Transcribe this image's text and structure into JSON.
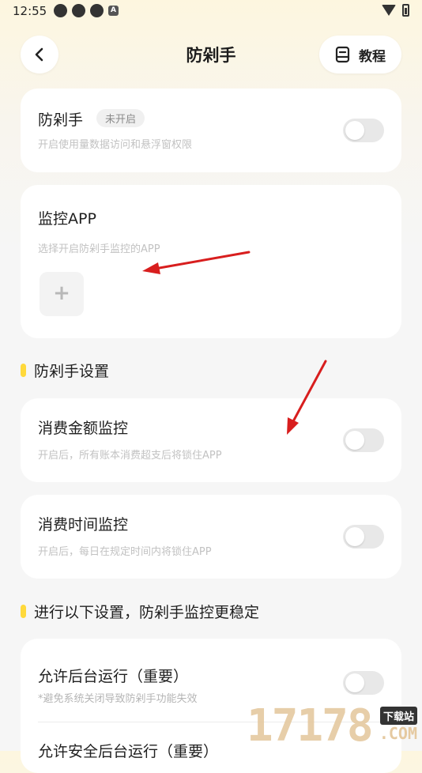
{
  "status_bar": {
    "time": "12:55",
    "a_icon": "A"
  },
  "header": {
    "title": "防剁手",
    "tutorial_label": "教程"
  },
  "card_main": {
    "title": "防剁手",
    "badge": "未开启",
    "subtitle": "开启使用量数据访问和悬浮窗权限",
    "toggle_on": false
  },
  "card_monitor": {
    "title": "监控APP",
    "subtitle": "选择开启防剁手监控的APP",
    "add_icon": "+"
  },
  "section_settings": {
    "title": "防剁手设置"
  },
  "card_amount": {
    "title": "消费金额监控",
    "subtitle": "开启后，所有账本消费超支后将锁住APP",
    "toggle_on": false
  },
  "card_time": {
    "title": "消费时间监控",
    "subtitle": "开启后，每日在规定时间内将锁住APP",
    "toggle_on": false
  },
  "section_stable": {
    "title": "进行以下设置，防剁手监控更稳定"
  },
  "card_background": {
    "item1": {
      "title": "允许后台运行（重要）",
      "subtitle": "*避免系统关闭导致防剁手功能失效",
      "toggle_on": false
    },
    "item2": {
      "title": "允许安全后台运行（重要）"
    }
  },
  "watermark": {
    "digits": "17178",
    "badge": "下载站",
    "suffix": ".COM"
  },
  "colors": {
    "accent_yellow": "#ffd93b",
    "arrow_red": "#d81e1e",
    "toggle_off": "#e8e8e8"
  }
}
